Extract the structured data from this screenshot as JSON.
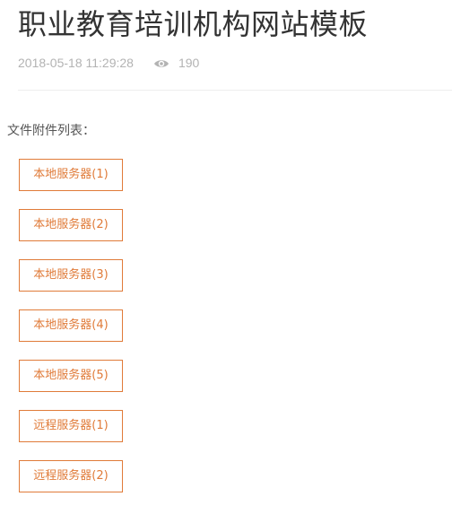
{
  "article": {
    "title": "职业教育培训机构网站模板",
    "datetime": "2018-05-18 11:29:28",
    "views": "190",
    "view_icon": "eye-icon"
  },
  "attachments": {
    "label": "文件附件列表：",
    "items": [
      {
        "label": "本地服务器(1)"
      },
      {
        "label": "本地服务器(2)"
      },
      {
        "label": "本地服务器(3)"
      },
      {
        "label": "本地服务器(4)"
      },
      {
        "label": "本地服务器(5)"
      },
      {
        "label": "远程服务器(1)"
      },
      {
        "label": "远程服务器(2)"
      }
    ]
  },
  "colors": {
    "accent": "#e07b39",
    "meta_text": "#b3b3b3",
    "title_text": "#333333"
  }
}
